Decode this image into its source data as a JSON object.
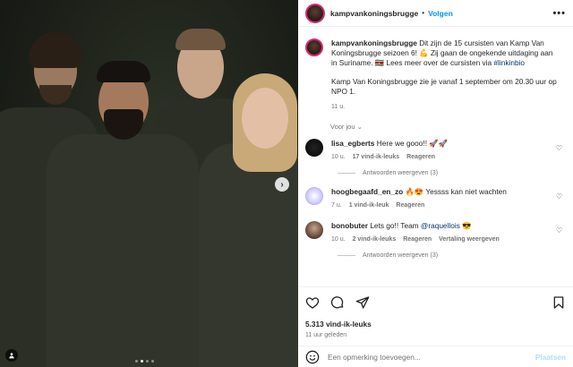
{
  "post": {
    "username": "kampvankoningsbrugge",
    "follow_label": "Volgen",
    "more_label": "•••",
    "caption_user": "kampvankoningsbrugge",
    "caption_p1": " Dit zijn de 15 cursisten van Kamp Van Koningsbrugge seizoen 6! 💪 Zij gaan de ongekende uitdaging aan in Suriname. 🇸🇷 Lees meer over de cursisten via ",
    "caption_link": "#linkinbio",
    "caption_p2": "Kamp Van Koningsbrugge zie je vanaf 1 september om 20.30 uur op NPO 1.",
    "caption_time": "11 u.",
    "translate_label": "Voor jou",
    "translate_chevron": "⌄"
  },
  "comments": [
    {
      "user": "lisa_egberts",
      "text": " Here we gooo!! 🚀🚀",
      "time": "10 u.",
      "likes": "17 vind-ik-leuks",
      "reply": "Reageren",
      "replies": "Antwoorden weergeven (3)"
    },
    {
      "user": "hoogbegaafd_en_zo",
      "text": " 🔥😍 Yessss kan niet wachten",
      "time": "7 u.",
      "likes": "1 vind-ik-leuk",
      "reply": "Reageren"
    },
    {
      "user": "bonobuter",
      "text_before": " Lets go!! Team ",
      "mention": "@raquellois",
      "text_after": " 😎",
      "time": "10 u.",
      "likes": "2 vind-ik-leuks",
      "reply": "Reageren",
      "translate": "Vertaling weergeven",
      "replies": "Antwoorden weergeven (3)"
    }
  ],
  "stats": {
    "likes": "5.313 vind-ik-leuks",
    "time": "11 uur geleden"
  },
  "composer": {
    "placeholder": "Een opmerking toevoegen...",
    "post_label": "Plaatsen"
  },
  "carousel": {
    "next_arrow": "›",
    "slides": 4,
    "active": 1
  },
  "icons": {
    "emoji": "emoji-icon",
    "heart": "heart-icon",
    "comment": "comment-icon",
    "share": "share-icon",
    "bookmark": "bookmark-icon",
    "user_tag": "user-tag-icon"
  },
  "colors": {
    "link": "#0095f6",
    "mention": "#00376b",
    "post_disabled": "#b3dbff",
    "story_ring": "#d62976"
  }
}
